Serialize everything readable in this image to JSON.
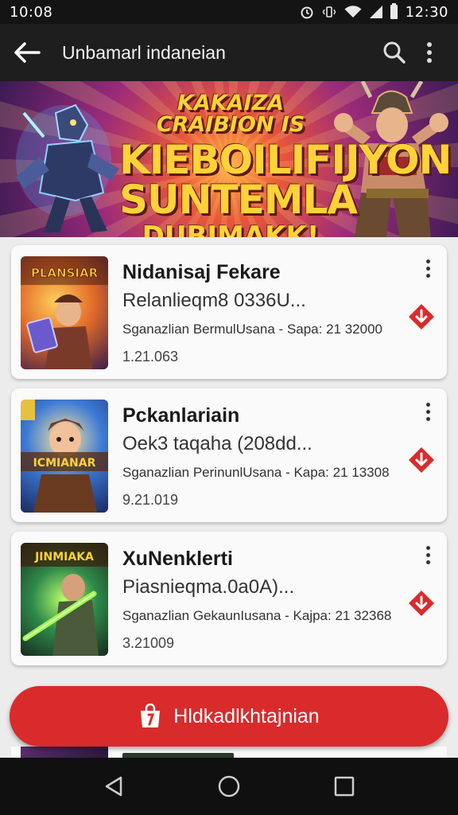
{
  "status_bar": {
    "time_left": "10:08",
    "time_right": "12:30"
  },
  "app_bar": {
    "title": "Unbamarl indaneian"
  },
  "banner": {
    "line1": "KAKAIZA CRAIBION IS",
    "line2": "KIEBOILIFIJYON SUNTEMLA",
    "line3": "DUBIMAKK!"
  },
  "items": [
    {
      "title": "Nidanisaj Fekare",
      "subtitle": "Relanlieqm8 0336U...",
      "meta": "Sganazlian BermulUsana - Sapa: 21 32000",
      "version": "1.21.063",
      "thumb_label": "PLANSIAR"
    },
    {
      "title": "Pckanlariain",
      "subtitle": "Oek3 taqaha (208dd...",
      "meta": "Sganazlian PerinunlUsana - Kapa: 21 13308",
      "version": "9.21.019",
      "thumb_label": "ICMIANAR"
    },
    {
      "title": "XuNenklerti",
      "subtitle": "Piasnieqma.0a0A)...",
      "meta": "Sganazlian GekaunIusana - Kajpa: 21 32368",
      "version": "3.21009",
      "thumb_label": "JINMIAKA"
    }
  ],
  "cta": {
    "label": "Hldkadlkhtajnian"
  },
  "colors": {
    "accent": "#d92b2b",
    "app_bar": "#1e1e1e",
    "card": "#fafafa"
  }
}
